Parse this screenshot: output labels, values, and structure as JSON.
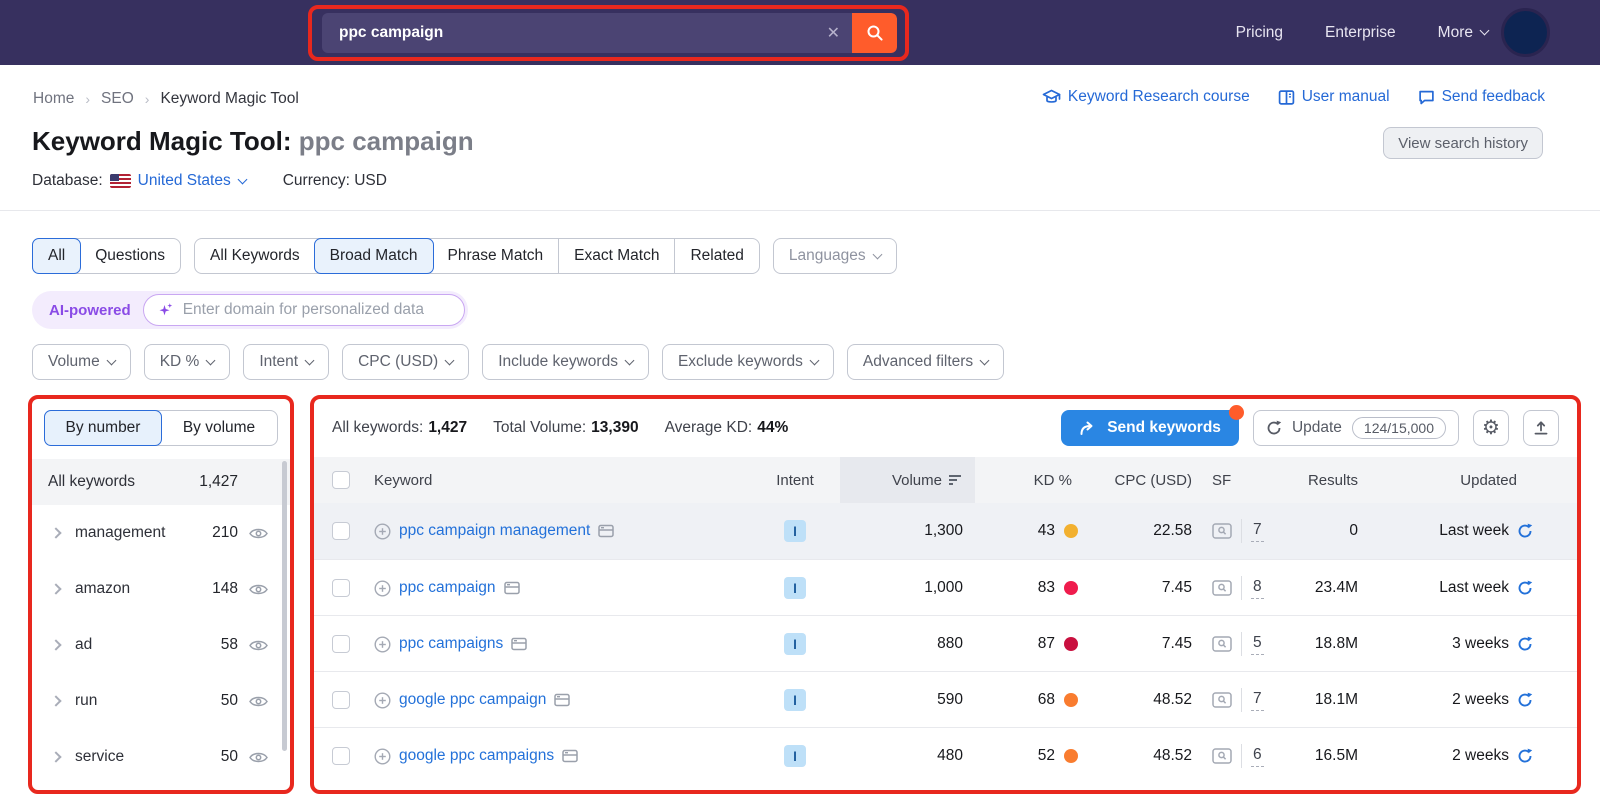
{
  "topbar": {
    "search_value": "ppc campaign",
    "nav": [
      "Pricing",
      "Enterprise",
      "More"
    ]
  },
  "breadcrumb": {
    "items": [
      "Home",
      "SEO",
      "Keyword Magic Tool"
    ]
  },
  "header": {
    "title": "Keyword Magic Tool:",
    "query": "ppc campaign",
    "database_label": "Database:",
    "database_value": "United States",
    "currency_label": "Currency:",
    "currency_value": "USD",
    "links": [
      "Keyword Research course",
      "User manual",
      "Send feedback"
    ],
    "history_button": "View search history"
  },
  "tabs": {
    "group1": [
      "All",
      "Questions"
    ],
    "group2": [
      "All Keywords",
      "Broad Match",
      "Phrase Match",
      "Exact Match",
      "Related"
    ],
    "languages": "Languages"
  },
  "ai_bar": {
    "badge": "AI-powered",
    "placeholder": "Enter domain for personalized data"
  },
  "filters": [
    "Volume",
    "KD %",
    "Intent",
    "CPC (USD)",
    "Include keywords",
    "Exclude keywords",
    "Advanced filters"
  ],
  "sidebar": {
    "toggle": [
      "By number",
      "By volume"
    ],
    "all_label": "All keywords",
    "all_count": "1,427",
    "groups": [
      {
        "label": "management",
        "count": "210"
      },
      {
        "label": "amazon",
        "count": "148"
      },
      {
        "label": "ad",
        "count": "58"
      },
      {
        "label": "run",
        "count": "50"
      },
      {
        "label": "service",
        "count": "50"
      }
    ]
  },
  "table": {
    "stats": {
      "keywords_label": "All keywords:",
      "keywords_value": "1,427",
      "volume_label": "Total Volume:",
      "volume_value": "13,390",
      "kd_label": "Average KD:",
      "kd_value": "44%"
    },
    "send_button": "Send keywords",
    "update_button": "Update",
    "update_quota": "124/15,000",
    "columns": {
      "keyword": "Keyword",
      "intent": "Intent",
      "volume": "Volume",
      "kd": "KD %",
      "cpc": "CPC (USD)",
      "sf": "SF",
      "results": "Results",
      "updated": "Updated"
    },
    "rows": [
      {
        "keyword": "ppc campaign management",
        "intent": "I",
        "volume": "1,300",
        "kd": "43",
        "kd_color": "#F2B02F",
        "cpc": "22.58",
        "sf": "7",
        "results": "0",
        "updated": "Last week"
      },
      {
        "keyword": "ppc campaign",
        "intent": "I",
        "volume": "1,000",
        "kd": "83",
        "kd_color": "#EF1C4D",
        "cpc": "7.45",
        "sf": "8",
        "results": "23.4M",
        "updated": "Last week"
      },
      {
        "keyword": "ppc campaigns",
        "intent": "I",
        "volume": "880",
        "kd": "87",
        "kd_color": "#C9103F",
        "cpc": "7.45",
        "sf": "5",
        "results": "18.8M",
        "updated": "3 weeks"
      },
      {
        "keyword": "google ppc campaign",
        "intent": "I",
        "volume": "590",
        "kd": "68",
        "kd_color": "#F97C2F",
        "cpc": "48.52",
        "sf": "7",
        "results": "18.1M",
        "updated": "2 weeks"
      },
      {
        "keyword": "google ppc campaigns",
        "intent": "I",
        "volume": "480",
        "kd": "52",
        "kd_color": "#F97C2F",
        "cpc": "48.52",
        "sf": "6",
        "results": "16.5M",
        "updated": "2 weeks"
      }
    ]
  },
  "colors": {
    "annotation_red": "#E8281E",
    "topbar_purple": "#37305F",
    "brand_orange": "#FF5C2B",
    "accent_blue": "#2569D6",
    "send_blue": "#2A86E3"
  }
}
